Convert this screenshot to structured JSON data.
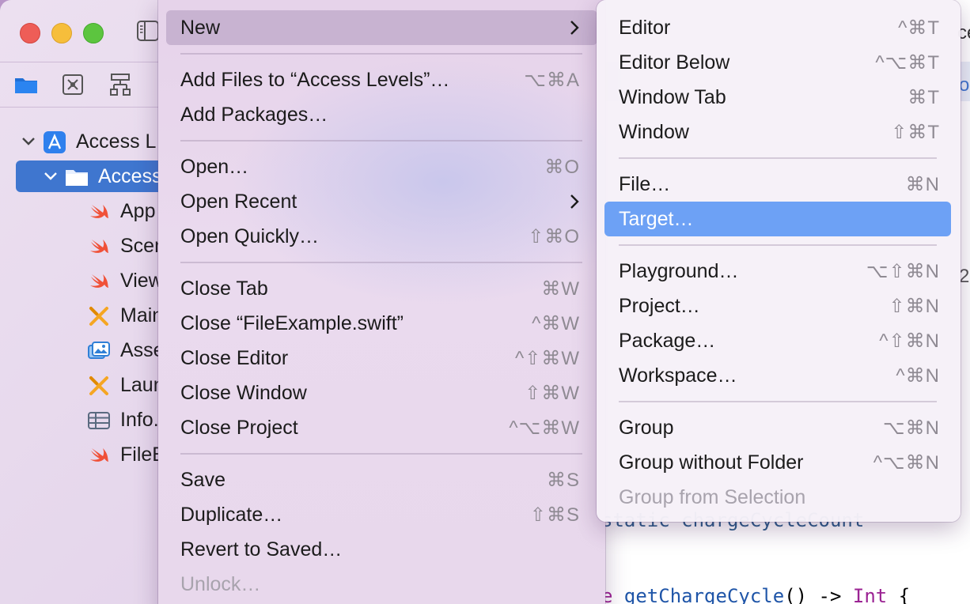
{
  "window": {
    "sidebar": {
      "items": [
        {
          "label": "Access L",
          "icon": "app-project-icon",
          "expanded": true
        },
        {
          "label": "Access",
          "icon": "folder-icon",
          "expanded": true,
          "selected": true
        },
        {
          "label": "App",
          "icon": "swift-file-icon"
        },
        {
          "label": "Scen",
          "icon": "swift-file-icon"
        },
        {
          "label": "View",
          "icon": "swift-file-icon"
        },
        {
          "label": "Main",
          "icon": "storyboard-icon"
        },
        {
          "label": "Asse",
          "icon": "asset-catalog-icon"
        },
        {
          "label": "Laun",
          "icon": "storyboard-icon"
        },
        {
          "label": "Info.",
          "icon": "plist-icon"
        },
        {
          "label": "FileE",
          "icon": "swift-file-icon"
        }
      ]
    },
    "editor": {
      "edge_text_top": "ce",
      "edge_text_tab": "ol",
      "edge_text_number": "2",
      "code_partial_1": "static chargeCycleCount",
      "code_line_2_prefix": "e ",
      "code_line_2_fn": "getChargeCycle",
      "code_line_2_rest": "() -> ",
      "code_line_2_type": "Int",
      "code_line_2_end": " {"
    }
  },
  "file_menu": {
    "items": [
      {
        "label": "New",
        "shortcut": "",
        "submenu": true,
        "highlighted": true
      },
      {
        "separator": true
      },
      {
        "label": "Add Files to “Access Levels”…",
        "shortcut": "⌥⌘A"
      },
      {
        "label": "Add Packages…",
        "shortcut": ""
      },
      {
        "separator": true
      },
      {
        "label": "Open…",
        "shortcut": "⌘O"
      },
      {
        "label": "Open Recent",
        "shortcut": "",
        "submenu": true
      },
      {
        "label": "Open Quickly…",
        "shortcut": "⇧⌘O"
      },
      {
        "separator": true
      },
      {
        "label": "Close Tab",
        "shortcut": "⌘W"
      },
      {
        "label": "Close “FileExample.swift”",
        "shortcut": "^⌘W"
      },
      {
        "label": "Close Editor",
        "shortcut": "^⇧⌘W"
      },
      {
        "label": "Close Window",
        "shortcut": "⇧⌘W"
      },
      {
        "label": "Close Project",
        "shortcut": "^⌥⌘W"
      },
      {
        "separator": true
      },
      {
        "label": "Save",
        "shortcut": "⌘S"
      },
      {
        "label": "Duplicate…",
        "shortcut": "⇧⌘S"
      },
      {
        "label": "Revert to Saved…",
        "shortcut": ""
      },
      {
        "label": "Unlock…",
        "shortcut": "",
        "disabled": true
      }
    ]
  },
  "new_submenu": {
    "items": [
      {
        "label": "Editor",
        "shortcut": "^⌘T"
      },
      {
        "label": "Editor Below",
        "shortcut": "^⌥⌘T"
      },
      {
        "label": "Window Tab",
        "shortcut": "⌘T"
      },
      {
        "label": "Window",
        "shortcut": "⇧⌘T"
      },
      {
        "separator": true
      },
      {
        "label": "File…",
        "shortcut": "⌘N"
      },
      {
        "label": "Target…",
        "shortcut": "",
        "highlighted": true
      },
      {
        "separator": true
      },
      {
        "label": "Playground…",
        "shortcut": "⌥⇧⌘N"
      },
      {
        "label": "Project…",
        "shortcut": "⇧⌘N"
      },
      {
        "label": "Package…",
        "shortcut": "^⇧⌘N"
      },
      {
        "label": "Workspace…",
        "shortcut": "^⌘N"
      },
      {
        "separator": true
      },
      {
        "label": "Group",
        "shortcut": "⌥⌘N"
      },
      {
        "label": "Group without Folder",
        "shortcut": "^⌥⌘N"
      },
      {
        "label": "Group from Selection",
        "shortcut": "",
        "disabled": true
      }
    ]
  },
  "colors": {
    "selection_blue": "#3f76cf",
    "menu_highlight_blue": "#6da1f5",
    "shortcut_gray": "#8f8a93",
    "disabled_gray": "#a8a3ad"
  }
}
